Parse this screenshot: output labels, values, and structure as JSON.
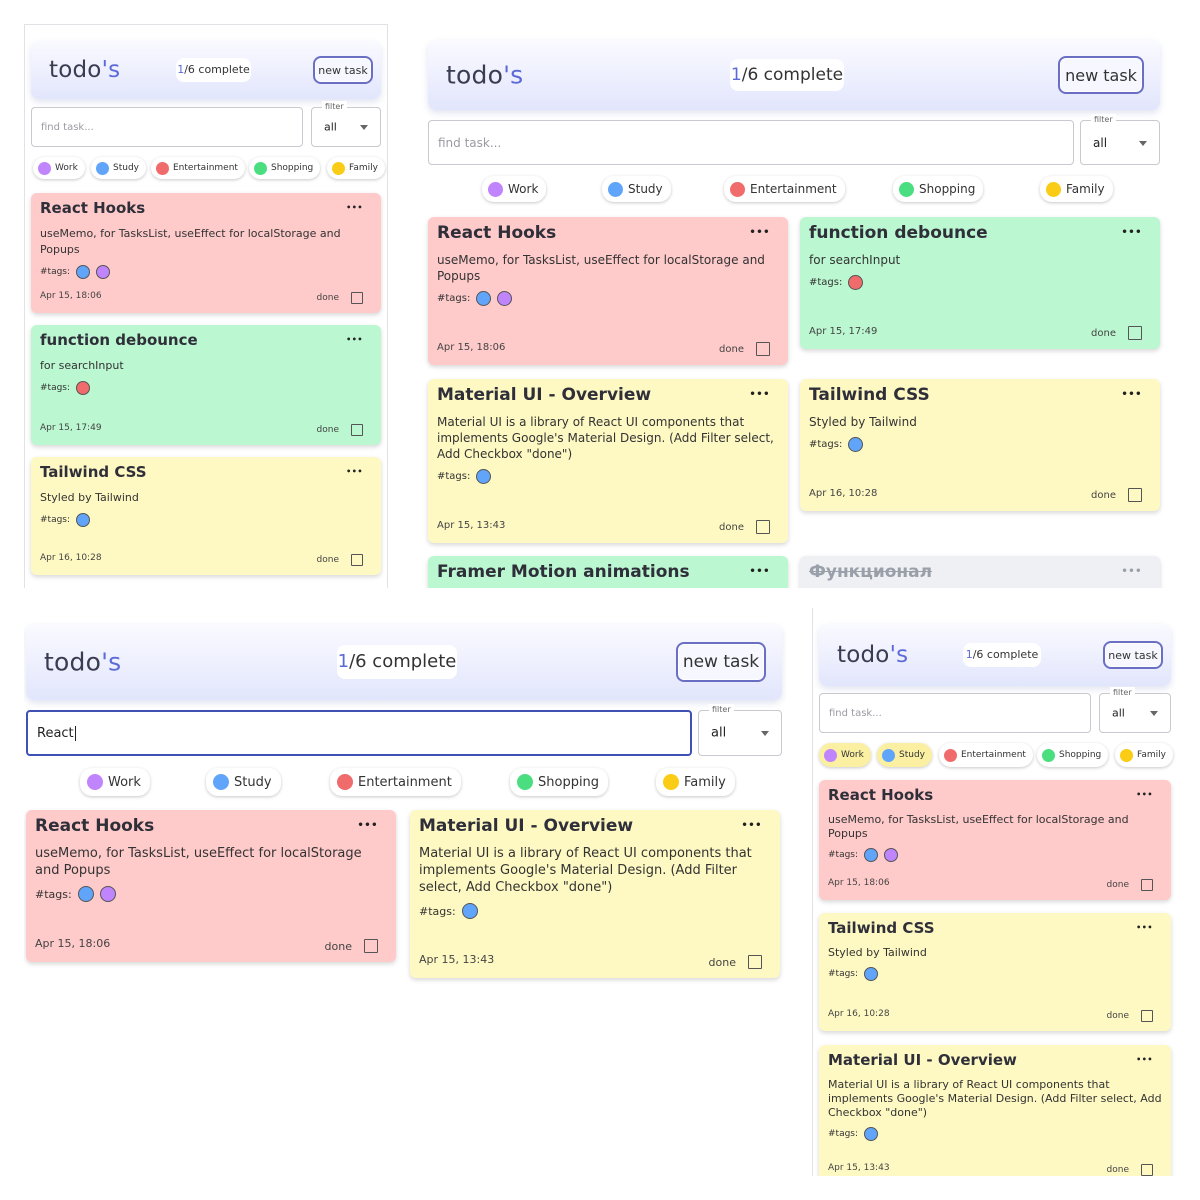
{
  "app": {
    "logo_main": "todo",
    "logo_accent": "'s",
    "progress_done": "1",
    "progress_rest": "/6 complete",
    "new_task_label": "new task",
    "search_placeholder": "find task...",
    "filter_label": "filter",
    "filter_value": "all",
    "done_label": "done",
    "tags_label": "#tags:"
  },
  "colors": {
    "accent": "#5c6ad8",
    "card_red": "#fecaca",
    "card_green": "#bbf7d0",
    "card_yellow": "#fef9c3",
    "card_archived": "#eef0f3",
    "chip_selected": "#fbf0a2"
  },
  "categories": [
    {
      "name": "Work",
      "color": "#c084fc"
    },
    {
      "name": "Study",
      "color": "#60a5fa"
    },
    {
      "name": "Entertainment",
      "color": "#f06b6b"
    },
    {
      "name": "Shopping",
      "color": "#4ade80"
    },
    {
      "name": "Family",
      "color": "#facc15"
    }
  ],
  "tasks": {
    "react_hooks": {
      "title": "React Hooks",
      "description": "useMemo, for TasksList, useEffect for localStorage and Popups",
      "tags": [
        "#60a5fa",
        "#c084fc"
      ],
      "date": "Apr 15, 18:06",
      "theme": "red"
    },
    "debounce": {
      "title": "function debounce",
      "description": "for searchInput",
      "tags": [
        "#f06b6b"
      ],
      "date": "Apr 15, 17:49",
      "theme": "green"
    },
    "tailwind": {
      "title": "Tailwind CSS",
      "description": "Styled by Tailwind",
      "tags": [
        "#60a5fa"
      ],
      "date": "Apr 16, 10:28",
      "theme": "yellow"
    },
    "material": {
      "title": "Material UI - Overview",
      "description": "Material UI is a library of React UI components that implements Google's Material Design. (Add Filter select, Add Checkbox \"done\")",
      "tags": [
        "#60a5fa"
      ],
      "date": "Apr 15, 13:43",
      "theme": "yellow"
    },
    "framer": {
      "title": "Framer Motion animations",
      "theme": "green"
    },
    "funktsional": {
      "title": "Функционал",
      "theme": "gray"
    }
  },
  "panels": [
    {
      "id": "mobile-default",
      "search_value": "",
      "selected_chips": [],
      "cards": [
        "react_hooks",
        "debounce",
        "tailwind"
      ]
    },
    {
      "id": "desktop-default",
      "search_value": "",
      "selected_chips": [],
      "cards": [
        "react_hooks",
        "debounce",
        "material",
        "tailwind",
        "framer",
        "funktsional"
      ]
    },
    {
      "id": "desktop-search",
      "search_value": "React",
      "selected_chips": [],
      "cards": [
        "react_hooks",
        "material"
      ]
    },
    {
      "id": "mobile-chip-filter",
      "search_value": "",
      "selected_chips": [
        "Work",
        "Study"
      ],
      "cards": [
        "react_hooks",
        "tailwind",
        "material"
      ]
    }
  ]
}
